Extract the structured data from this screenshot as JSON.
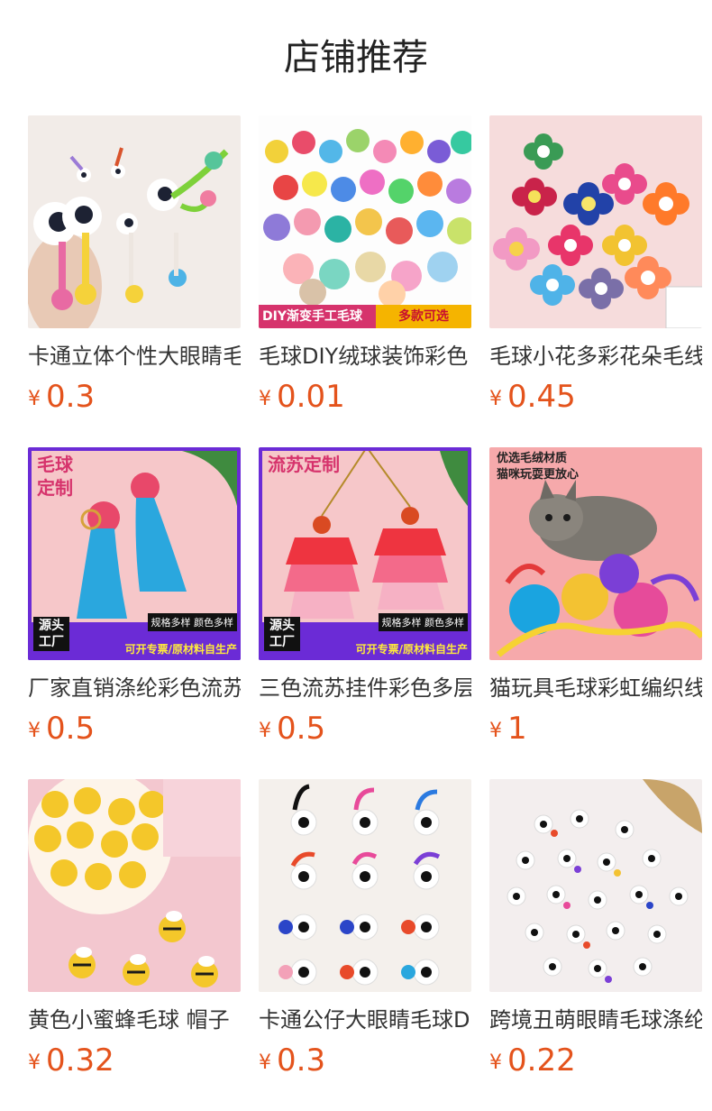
{
  "page": {
    "title": "店铺推荐"
  },
  "currency_symbol": "¥",
  "products": [
    {
      "name": "卡通立体个性大眼睛毛",
      "price": "0.3"
    },
    {
      "name": "毛球DIY绒球装饰彩色",
      "price": "0.01",
      "overlay": {
        "left": "DIY渐变手工毛球",
        "right": "多款可选"
      }
    },
    {
      "name": "毛球小花多彩花朵毛线",
      "price": "0.45"
    },
    {
      "name": "厂家直销涤纶彩色流苏",
      "price": "0.5",
      "overlay": {
        "title": "毛球\n定制",
        "source": "源头\n工厂",
        "spec": "规格多样 颜色多样",
        "prod": "可开专票/原材料自生产"
      }
    },
    {
      "name": "三色流苏挂件彩色多层",
      "price": "0.5",
      "overlay": {
        "title": "流苏定制",
        "source": "源头\n工厂",
        "spec": "规格多样 颜色多样",
        "prod": "可开专票/原材料自生产"
      }
    },
    {
      "name": "猫玩具毛球彩虹编织线",
      "price": "1",
      "overlay": {
        "title": "优选毛绒材质\n猫咪玩耍更放心"
      }
    },
    {
      "name": "黄色小蜜蜂毛球 帽子",
      "price": "0.32"
    },
    {
      "name": "卡通公仔大眼睛毛球DIY",
      "price": "0.3"
    },
    {
      "name": "跨境丑萌眼睛毛球涤纶",
      "price": "0.22"
    }
  ],
  "colors": {
    "price": "#e4531c",
    "title": "#222222",
    "name": "#333333"
  }
}
